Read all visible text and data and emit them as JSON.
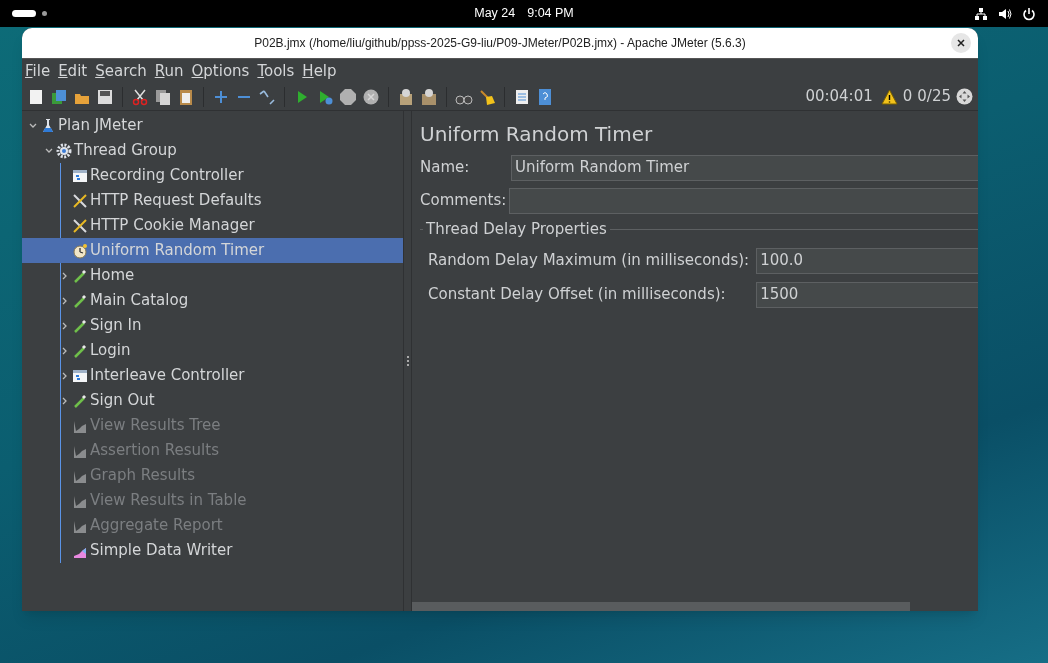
{
  "top_bar": {
    "date": "May 24",
    "time": "9:04 PM"
  },
  "window": {
    "title": "P02B.jmx (/home/liu/github/ppss-2025-G9-liu/P09-JMeter/P02B.jmx) - Apache JMeter (5.6.3)"
  },
  "menu": [
    "File",
    "Edit",
    "Search",
    "Run",
    "Options",
    "Tools",
    "Help"
  ],
  "status": {
    "elapsed": "00:04:01",
    "warnings": "0",
    "threads": "0/25"
  },
  "tree": [
    {
      "label": "Plan JMeter",
      "kind": "plan",
      "expanded": true,
      "selected": false,
      "disabled": false,
      "children": [
        {
          "label": "Thread Group",
          "kind": "group",
          "expanded": true,
          "selected": false,
          "disabled": false,
          "children": [
            {
              "label": "Recording Controller",
              "kind": "controller",
              "selected": false,
              "disabled": false
            },
            {
              "label": "HTTP Request Defaults",
              "kind": "config",
              "selected": false,
              "disabled": false
            },
            {
              "label": "HTTP Cookie Manager",
              "kind": "config",
              "selected": false,
              "disabled": false
            },
            {
              "label": "Uniform Random Timer",
              "kind": "timer",
              "selected": true,
              "disabled": false
            },
            {
              "label": "Home",
              "kind": "sampler",
              "expanded": false,
              "selected": false,
              "disabled": false
            },
            {
              "label": "Main Catalog",
              "kind": "sampler",
              "expanded": false,
              "selected": false,
              "disabled": false
            },
            {
              "label": "Sign In",
              "kind": "sampler",
              "expanded": false,
              "selected": false,
              "disabled": false
            },
            {
              "label": "Login",
              "kind": "sampler",
              "expanded": false,
              "selected": false,
              "disabled": false
            },
            {
              "label": "Interleave Controller",
              "kind": "controller",
              "expanded": false,
              "selected": false,
              "disabled": false
            },
            {
              "label": "Sign Out",
              "kind": "sampler",
              "expanded": false,
              "selected": false,
              "disabled": false
            },
            {
              "label": "View Results Tree",
              "kind": "listener",
              "selected": false,
              "disabled": true
            },
            {
              "label": "Assertion Results",
              "kind": "listener",
              "selected": false,
              "disabled": true
            },
            {
              "label": "Graph Results",
              "kind": "listener",
              "selected": false,
              "disabled": true
            },
            {
              "label": "View Results in Table",
              "kind": "listener",
              "selected": false,
              "disabled": true
            },
            {
              "label": "Aggregate Report",
              "kind": "listener",
              "selected": false,
              "disabled": true
            },
            {
              "label": "Simple Data Writer",
              "kind": "writer",
              "selected": false,
              "disabled": false
            }
          ]
        }
      ]
    }
  ],
  "editor": {
    "title": "Uniform Random Timer",
    "name": {
      "label": "Name:",
      "value": "Uniform Random Timer"
    },
    "comments": {
      "label": "Comments:"
    },
    "section": {
      "title": "Thread Delay Properties",
      "fields": [
        {
          "label": "Random Delay Maximum (in milliseconds):",
          "value": "100.0"
        },
        {
          "label": "Constant Delay Offset (in milliseconds):",
          "value": "1500"
        }
      ]
    }
  }
}
